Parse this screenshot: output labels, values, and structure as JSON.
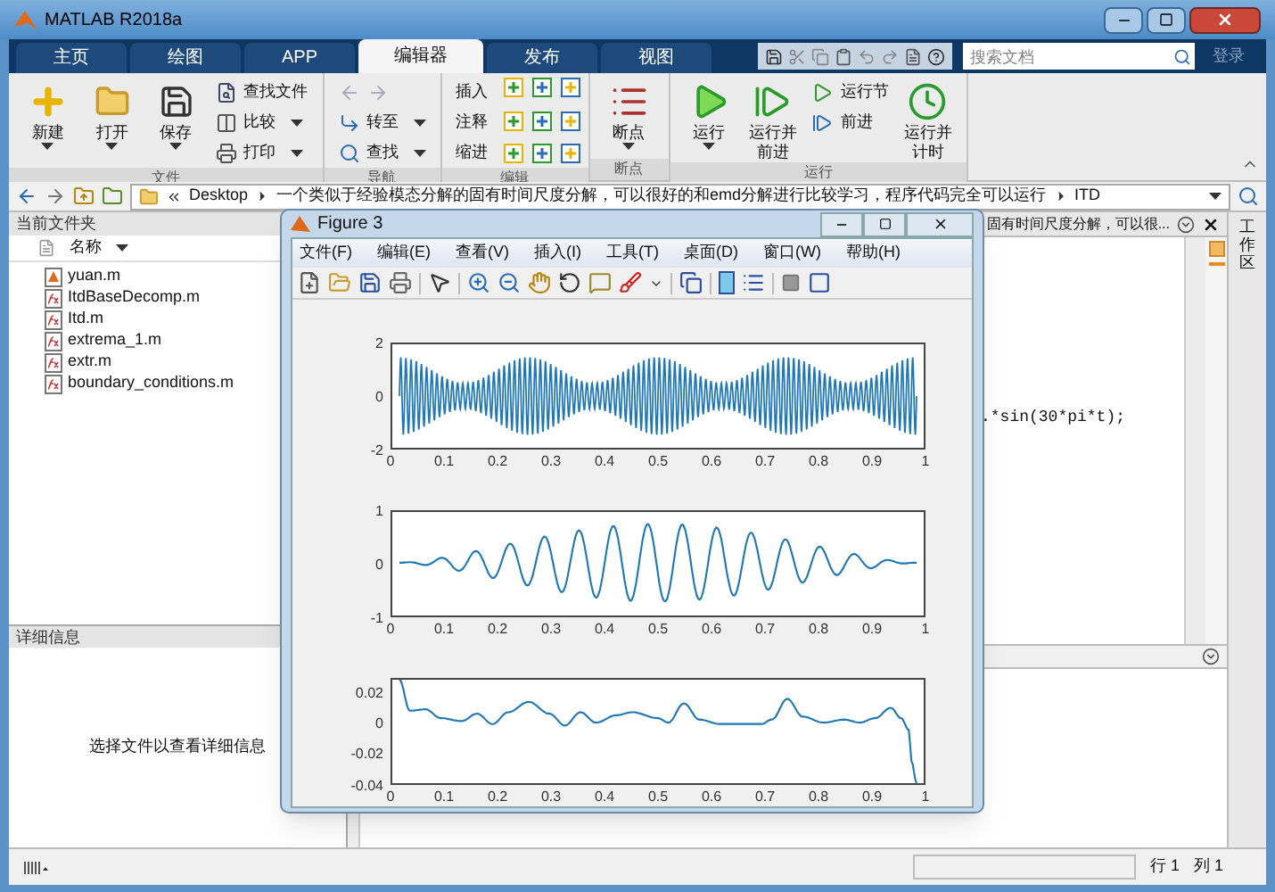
{
  "window": {
    "title": "MATLAB R2018a"
  },
  "tabs": [
    {
      "label": "主页",
      "selected": false
    },
    {
      "label": "绘图",
      "selected": false
    },
    {
      "label": "APP",
      "selected": false
    },
    {
      "label": "编辑器",
      "selected": true
    },
    {
      "label": "发布",
      "selected": false
    },
    {
      "label": "视图",
      "selected": false
    }
  ],
  "search": {
    "placeholder": "搜索文档"
  },
  "login": "登录",
  "ribbon": [
    {
      "label": "文件",
      "items": [
        {
          "kind": "large",
          "label": "新建",
          "dropdown": true
        },
        {
          "kind": "large",
          "label": "打开",
          "dropdown": true
        },
        {
          "kind": "large",
          "label": "保存",
          "dropdown": true
        },
        {
          "kind": "small",
          "label": "查找文件",
          "dropdown": false
        },
        {
          "kind": "small",
          "label": "比较",
          "dropdown": true
        },
        {
          "kind": "small",
          "label": "打印",
          "dropdown": true
        }
      ]
    },
    {
      "label": "导航",
      "items": [
        {
          "kind": "small",
          "label": "转至",
          "dropdown": true
        },
        {
          "kind": "small",
          "label": "查找",
          "dropdown": true
        }
      ]
    },
    {
      "label": "编辑",
      "items": [
        {
          "kind": "small",
          "label": "插入",
          "dropdown": false
        },
        {
          "kind": "small",
          "label": "注释",
          "dropdown": false
        },
        {
          "kind": "small",
          "label": "缩进",
          "dropdown": false
        }
      ]
    },
    {
      "label": "断点",
      "items": [
        {
          "kind": "large",
          "label": "断点",
          "dropdown": true
        }
      ]
    },
    {
      "label": "运行",
      "items": [
        {
          "kind": "large",
          "label": "运行",
          "dropdown": true
        },
        {
          "kind": "large",
          "label": "运行并前进",
          "dropdown": false
        },
        {
          "kind": "small",
          "label": "运行节",
          "dropdown": false
        },
        {
          "kind": "small",
          "label": "前进",
          "dropdown": false
        },
        {
          "kind": "large",
          "label": "运行并计时",
          "dropdown": false
        }
      ]
    }
  ],
  "address": {
    "path": [
      "Desktop",
      "一个类似于经验模态分解的固有时间尺度分解，可以很好的和emd分解进行比较学习，程序代码完全可以运行",
      "ITD"
    ]
  },
  "current_folder": {
    "title": "当前文件夹",
    "column": "名称",
    "files": [
      {
        "name": "yuan.m",
        "kind": "script"
      },
      {
        "name": "ItdBaseDecomp.m",
        "kind": "function"
      },
      {
        "name": "Itd.m",
        "kind": "function"
      },
      {
        "name": "extrema_1.m",
        "kind": "function"
      },
      {
        "name": "extr.m",
        "kind": "function"
      },
      {
        "name": "boundary_conditions.m",
        "kind": "function"
      }
    ]
  },
  "details": {
    "title": "详细信息",
    "message": "选择文件以查看详细信息"
  },
  "editor": {
    "tab_title": "固有时间尺度分解，可以很...",
    "code_line": ".*sin(30*pi*t);"
  },
  "workspace_tab": "工作区",
  "status_bar": {
    "row": "行 1",
    "col": "列 1"
  },
  "figure": {
    "title": "Figure 3",
    "menus": [
      "文件(F)",
      "编辑(E)",
      "查看(V)",
      "插入(I)",
      "工具(T)",
      "桌面(D)",
      "窗口(W)",
      "帮助(H)"
    ],
    "axes": [
      {
        "kind": "am",
        "yticks": [
          "2",
          "0",
          "-2"
        ],
        "xticks": [
          "0",
          "0.1",
          "0.2",
          "0.3",
          "0.4",
          "0.5",
          "0.6",
          "0.7",
          "0.8",
          "0.9",
          "1"
        ]
      },
      {
        "kind": "bell",
        "yticks": [
          "1",
          "0",
          "-1"
        ],
        "xticks": [
          "0",
          "0.1",
          "0.2",
          "0.3",
          "0.4",
          "0.5",
          "0.6",
          "0.7",
          "0.8",
          "0.9",
          "1"
        ]
      },
      {
        "kind": "residual",
        "yticks": [
          "0.02",
          "0",
          "-0.02",
          "-0.04"
        ],
        "xticks": [
          "0",
          "0.1",
          "0.2",
          "0.3",
          "0.4",
          "0.5",
          "0.6",
          "0.7",
          "0.8",
          "0.9",
          "1"
        ]
      }
    ]
  }
}
